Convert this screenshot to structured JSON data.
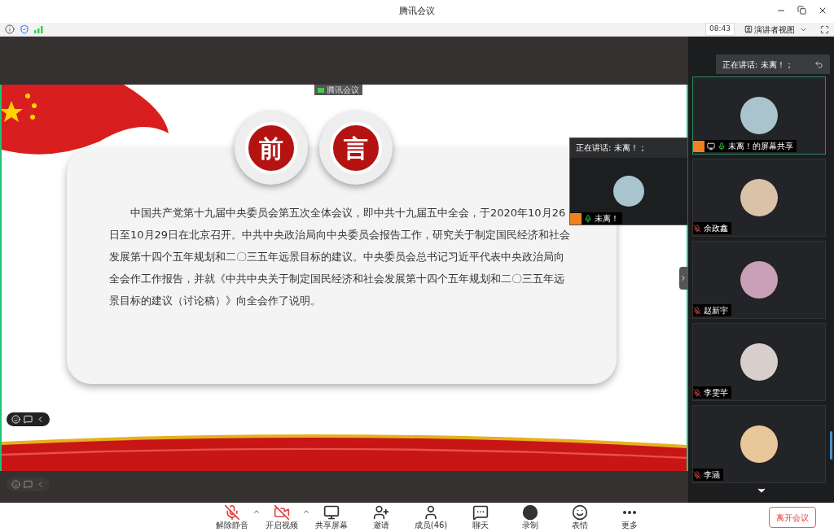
{
  "window": {
    "title": "腾讯会议"
  },
  "info_bar": {
    "time": "08:43",
    "view_mode": "演讲者视图"
  },
  "share_label": "腾讯会议",
  "slide": {
    "badges": [
      "前",
      "言"
    ],
    "paragraph": "中国共产党第十九届中央委员会第五次全体会议，即中共十九届五中全会，于2020年10月26日至10月29日在北京召开。中共中央政治局向中央委员会报告工作，研究关于制定国民经济和社会发展第十四个五年规划和二〇三五年远景目标的建议。中央委员会总书记习近平代表中央政治局向全会作工作报告，并就《中共中央关于制定国民经济和社会发展第十四个五年规划和二〇三五年远景目标的建议（讨论稿）》向全会作了说明。"
  },
  "floating_video": {
    "speaking": "正在讲话: 未离！；",
    "name": "未离！",
    "muted": false,
    "host": true
  },
  "sidebar": {
    "speaking": "正在讲话: 未离！；",
    "participants": [
      {
        "name": "未离！的屏幕共享",
        "host": true,
        "sharing": true,
        "muted": false,
        "selected": true,
        "color": "#a9c4cc"
      },
      {
        "name": "余政鑫",
        "host": false,
        "sharing": false,
        "muted": true,
        "selected": false,
        "color": "#d9c2a8"
      },
      {
        "name": "赵新宇",
        "host": false,
        "sharing": false,
        "muted": true,
        "selected": false,
        "color": "#c9a0b8"
      },
      {
        "name": "李雯芊",
        "host": false,
        "sharing": false,
        "muted": true,
        "selected": false,
        "color": "#d8cfcc"
      },
      {
        "name": "李涵",
        "host": false,
        "sharing": false,
        "muted": true,
        "selected": false,
        "color": "#e8c89a"
      }
    ]
  },
  "toolbar": [
    {
      "kind": "mic",
      "label": "解除静音",
      "caret": true
    },
    {
      "kind": "video",
      "label": "开启视频",
      "caret": true
    },
    {
      "kind": "share",
      "label": "共享屏幕",
      "caret": false
    },
    {
      "kind": "invite",
      "label": "邀请",
      "caret": false
    },
    {
      "kind": "members",
      "label": "成员(46)",
      "caret": false
    },
    {
      "kind": "chat",
      "label": "聊天",
      "caret": false
    },
    {
      "kind": "record",
      "label": "录制",
      "caret": false
    },
    {
      "kind": "emoji",
      "label": "表情",
      "caret": false
    },
    {
      "kind": "more",
      "label": "更多",
      "caret": false
    }
  ],
  "leave_button": "离开会议"
}
